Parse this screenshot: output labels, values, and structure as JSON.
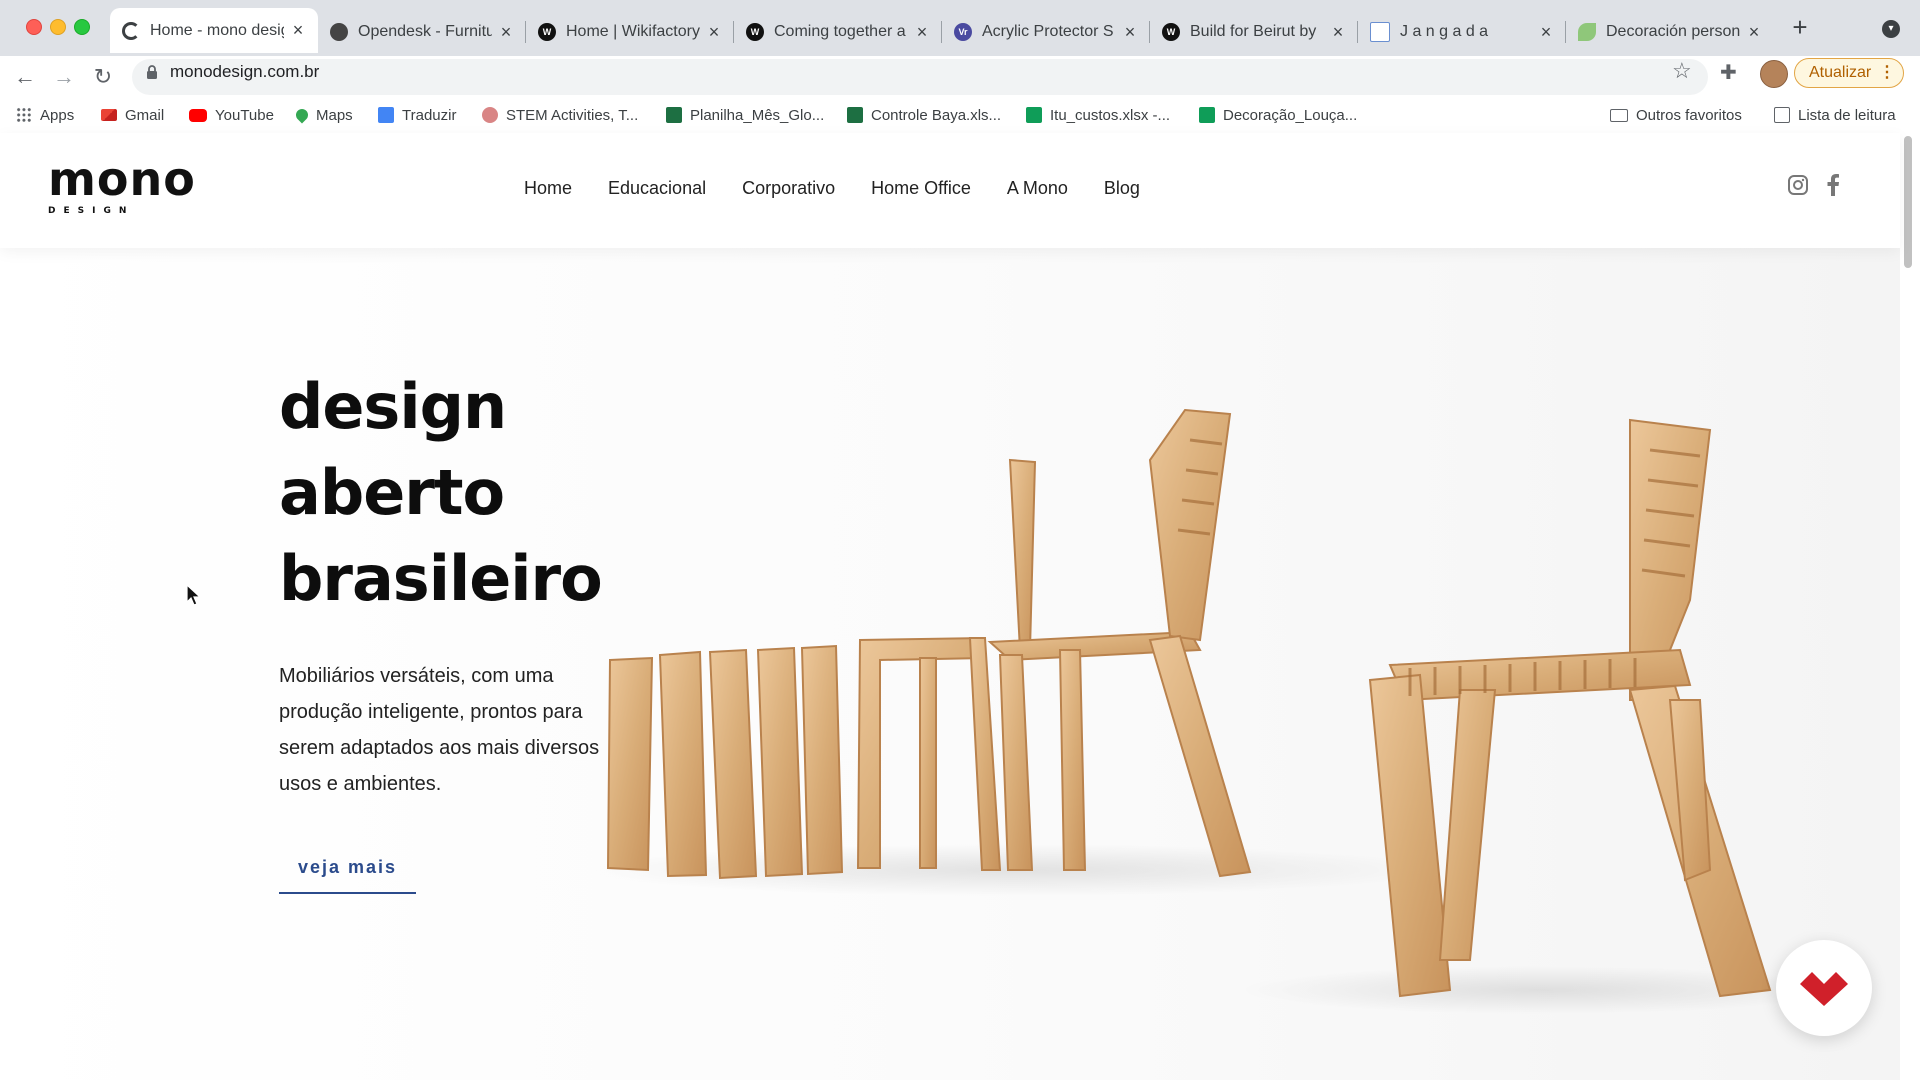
{
  "browser": {
    "tabs": [
      {
        "title": "Home - mono design",
        "active": true,
        "favicon": "loading-spinner-icon"
      },
      {
        "title": "Opendesk - Furniture",
        "active": false,
        "favicon": "opendesk-icon"
      },
      {
        "title": "Home | Wikifactory",
        "active": false,
        "favicon": "wikifactory-icon"
      },
      {
        "title": "Coming together a",
        "active": false,
        "favicon": "wikifactory-icon"
      },
      {
        "title": "Acrylic Protector S",
        "active": false,
        "favicon": "vr-icon"
      },
      {
        "title": "Build for Beirut by",
        "active": false,
        "favicon": "wikifactory-icon"
      },
      {
        "title": "J a n g a d a",
        "active": false,
        "favicon": "jangada-icon"
      },
      {
        "title": "Decoración person",
        "active": false,
        "favicon": "leaf-icon"
      }
    ],
    "url": "monodesign.com.br",
    "update_label": "Atualizar",
    "bookmarks": [
      {
        "label": "Apps",
        "icon": "apps-grid-icon"
      },
      {
        "label": "Gmail",
        "icon": "gmail-icon"
      },
      {
        "label": "YouTube",
        "icon": "youtube-icon"
      },
      {
        "label": "Maps",
        "icon": "maps-pin-icon"
      },
      {
        "label": "Traduzir",
        "icon": "translate-icon"
      },
      {
        "label": "STEM Activities, T...",
        "icon": "stem-icon"
      },
      {
        "label": "Planilha_Mês_Glo...",
        "icon": "excel-icon"
      },
      {
        "label": "Controle Baya.xls...",
        "icon": "excel-icon"
      },
      {
        "label": "Itu_custos.xlsx -...",
        "icon": "sheets-icon"
      },
      {
        "label": "Decoração_Louça...",
        "icon": "sheets-icon"
      }
    ],
    "other_bookmarks": "Outros favoritos",
    "reading_list": "Lista de leitura"
  },
  "site": {
    "logo_word": "mono",
    "logo_sub": "DESIGN",
    "nav": [
      "Home",
      "Educacional",
      "Corporativo",
      "Home Office",
      "A Mono",
      "Blog"
    ],
    "hero": {
      "title_lines": [
        "design",
        "aberto",
        "brasileiro"
      ],
      "description": "Mobiliários versáteis, com uma produção inteligente, prontos para serem adaptados aos mais diversos usos e ambientes.",
      "cta": "veja mais"
    }
  },
  "colors": {
    "accent": "#2b4b8c",
    "chat_icon": "#d0202a",
    "update_orange": "#b06000",
    "wood": "#d9ad78"
  }
}
